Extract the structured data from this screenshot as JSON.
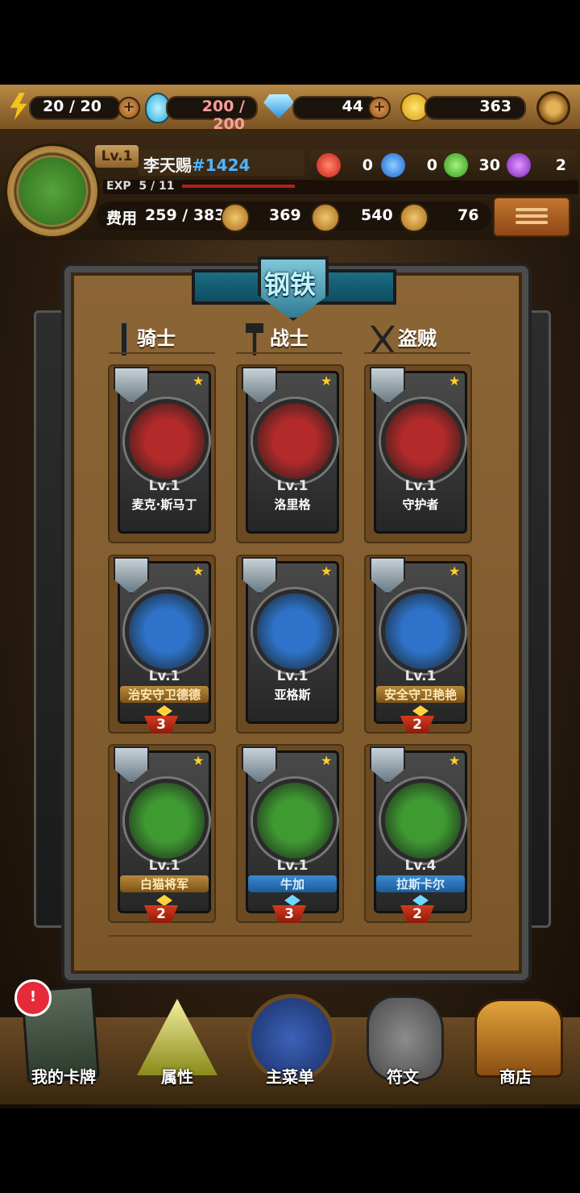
{
  "resources": {
    "energy": "20 / 20",
    "potion": "200 / 200",
    "diamond": "44",
    "coin": "363"
  },
  "player": {
    "level": "Lv.1",
    "name": "李天赐",
    "id": "#1424",
    "exp_label": "EXP",
    "exp": "5 / 11",
    "exp_progress": 0.45
  },
  "orbs": [
    {
      "color": "red",
      "value": "0"
    },
    {
      "color": "blue",
      "value": "0"
    },
    {
      "color": "green",
      "value": "30"
    },
    {
      "color": "purple",
      "value": "2"
    }
  ],
  "stats": {
    "cost_label": "费用",
    "cost": "259 / 383",
    "attack": "369",
    "hp": "540",
    "heal": "76"
  },
  "board": {
    "title": "钢铁",
    "classes": [
      {
        "label": "骑士",
        "icon": "sword-icon"
      },
      {
        "label": "战士",
        "icon": "axe-icon"
      },
      {
        "label": "盗贼",
        "icon": "crossed-daggers-icon"
      }
    ]
  },
  "cards": [
    {
      "level": "Lv.1",
      "name": "麦克·斯马丁",
      "style": "plain",
      "bg": "#b22a2a",
      "count": ""
    },
    {
      "level": "Lv.1",
      "name": "洛里格",
      "style": "plain",
      "bg": "#b22a2a",
      "count": ""
    },
    {
      "level": "Lv.1",
      "name": "守护者",
      "style": "plain",
      "bg": "#b22a2a",
      "count": ""
    },
    {
      "level": "Lv.1",
      "name": "治安守卫德德",
      "style": "gold",
      "bg": "#2e73c9",
      "count": "3"
    },
    {
      "level": "Lv.1",
      "name": "亚格斯",
      "style": "plain",
      "bg": "#2e73c9",
      "count": ""
    },
    {
      "level": "Lv.1",
      "name": "安全守卫艳艳",
      "style": "gold",
      "bg": "#2e73c9",
      "count": "2"
    },
    {
      "level": "Lv.1",
      "name": "白猫将军",
      "style": "gold",
      "bg": "#3f9a32",
      "count": "2"
    },
    {
      "level": "Lv.1",
      "name": "牛加",
      "style": "blue",
      "bg": "#3f9a32",
      "count": "3"
    },
    {
      "level": "Lv.4",
      "name": "拉斯卡尔",
      "style": "blue",
      "bg": "#3f9a32",
      "count": "2"
    }
  ],
  "nav": {
    "badge": "!",
    "items": [
      {
        "label": "我的卡牌",
        "icon": "cards-icon"
      },
      {
        "label": "属性",
        "icon": "triangle-crystal-icon"
      },
      {
        "label": "主菜单",
        "icon": "emblem-icon"
      },
      {
        "label": "符文",
        "icon": "rune-stone-icon"
      },
      {
        "label": "商店",
        "icon": "treasure-chest-icon"
      }
    ]
  }
}
